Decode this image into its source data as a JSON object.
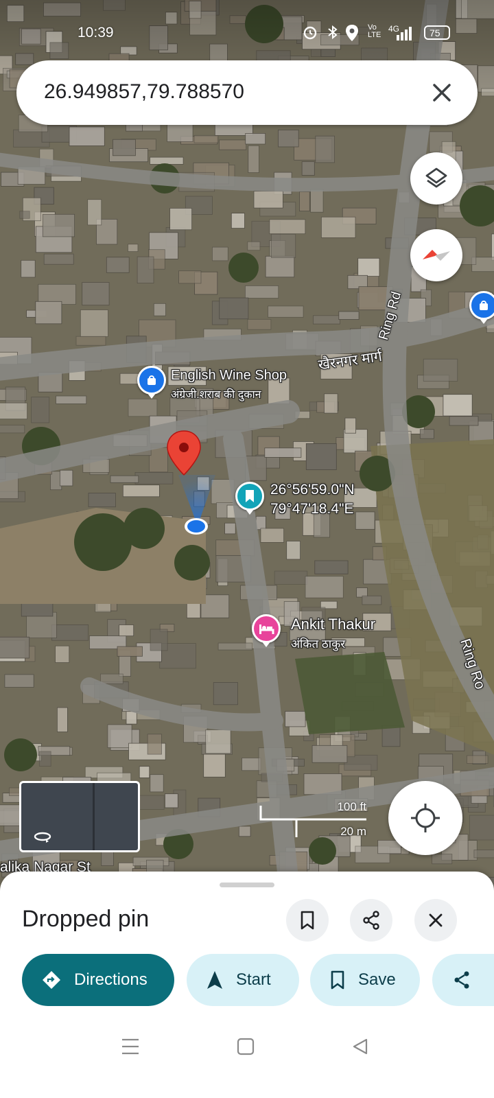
{
  "status_bar": {
    "time": "10:39",
    "network": "4G",
    "battery": "75",
    "volte": "Vo LTE"
  },
  "search": {
    "query": "26.949857,79.788570"
  },
  "map": {
    "roads": [
      {
        "name": "Ring Rd"
      },
      {
        "name": "खैरनगर मार्ग"
      },
      {
        "name": "Ring Ro"
      },
      {
        "name": "alika Nagar St"
      }
    ],
    "places": [
      {
        "name": "English Wine Shop",
        "subname": "अंग्रेजी.शराब की दुकान",
        "icon": "shopping-bag-icon",
        "color": "#1a73e8"
      },
      {
        "name": "26°56'59.0\"N",
        "subname": "79°47'18.4\"E",
        "icon": "bookmark-icon",
        "color": "#12a4b8"
      },
      {
        "name": "Ankit Thakur",
        "subname": "अंकित ठाकुर",
        "icon": "bed-icon",
        "color": "#e8449b"
      }
    ],
    "pin_color": "#ea4335",
    "location_dot_color": "#1a73e8",
    "scale": {
      "imperial": "100 ft",
      "metric": "20 m"
    }
  },
  "sheet": {
    "title": "Dropped pin",
    "actions": [
      {
        "label": "Directions",
        "icon": "directions-icon"
      },
      {
        "label": "Start",
        "icon": "navigation-arrow-icon"
      },
      {
        "label": "Save",
        "icon": "bookmark-icon"
      },
      {
        "label": "",
        "icon": "share-icon"
      }
    ]
  },
  "colors": {
    "primary": "#0b6f7b",
    "chip_bg": "#d8f1f7",
    "chip_text": "#0c3d4a"
  }
}
